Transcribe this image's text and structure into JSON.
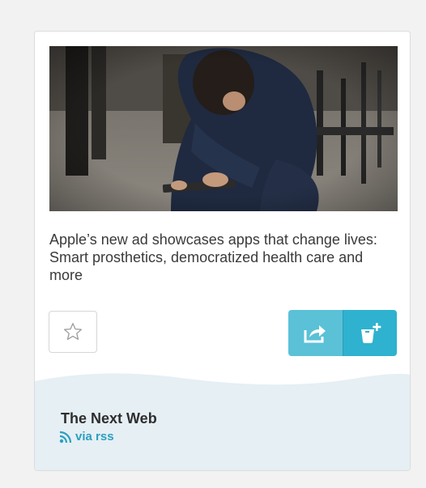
{
  "article": {
    "headline": "Apple’s new ad showcases apps that change lives: Smart prosthetics, democratized health care and more",
    "image_icon": "photo-child-using-tablet"
  },
  "actions": {
    "save_icon": "star-outline-icon",
    "share_icon": "share-arrow-icon",
    "collect_icon": "add-to-bucket-icon"
  },
  "source": {
    "name": "The Next Web",
    "via": "via rss",
    "via_icon": "rss-icon"
  },
  "colors": {
    "accent_light": "#5ac1d7",
    "accent_dark": "#2fb2cf",
    "link": "#2b9fbf",
    "footer_bg": "#e5eff4"
  }
}
